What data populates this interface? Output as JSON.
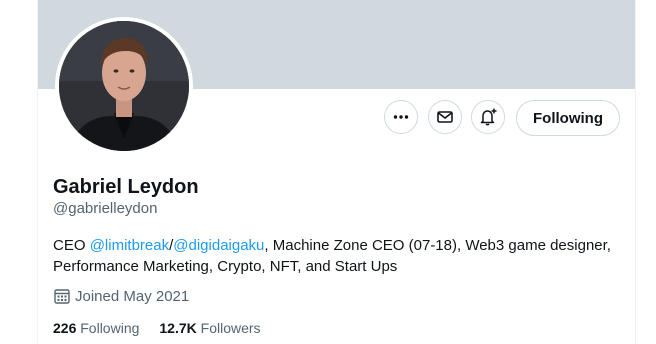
{
  "profile": {
    "name": "Gabriel Leydon",
    "handle": "@gabrielleydon",
    "bio": {
      "prefix": "CEO ",
      "link1": "@limitbreak",
      "sep": "/",
      "link2": "@digidaigaku",
      "rest_line1": ", Machine Zone CEO (07-18), Web3 game designer,",
      "line2": "Performance Marketing, Crypto, NFT, and Start Ups"
    },
    "joined": "Joined May 2021",
    "following_count": "226",
    "following_label": "Following",
    "followers_count": "12.7K",
    "followers_label": "Followers"
  },
  "actions": {
    "follow_state_label": "Following",
    "more_icon": "more-horizontal-icon",
    "message_icon": "envelope-icon",
    "notify_icon": "bell-plus-icon"
  },
  "colors": {
    "banner": "#cfd9de",
    "link": "#1d9bf0",
    "secondary_text": "#536471"
  }
}
